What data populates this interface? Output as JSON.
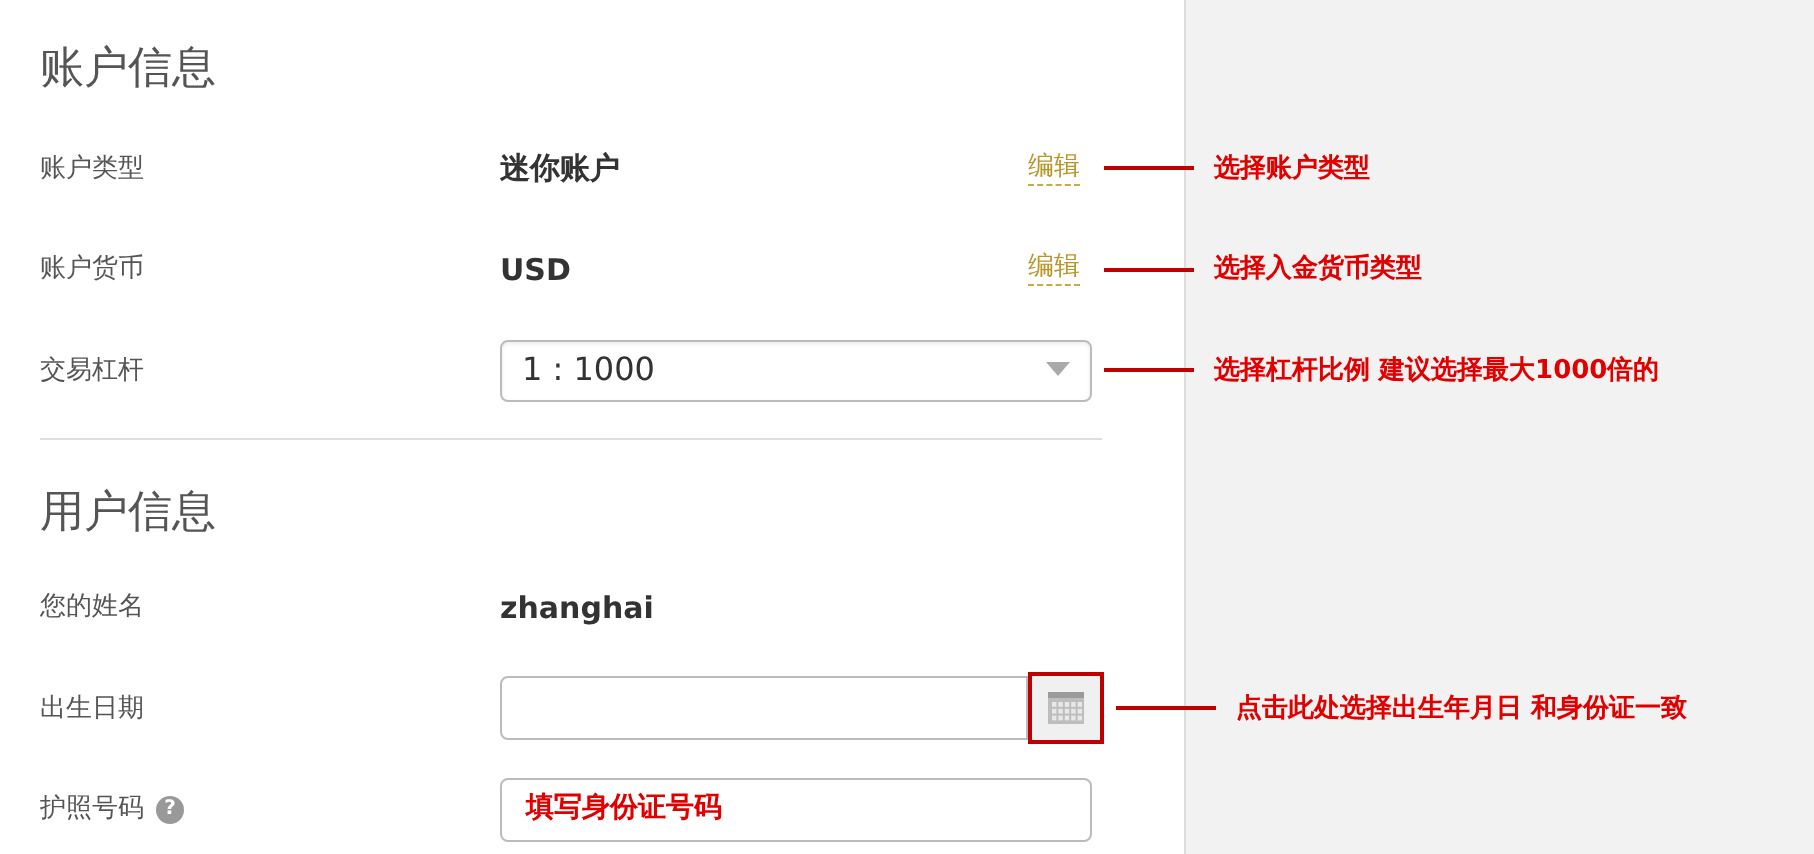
{
  "sections": [
    {
      "title": "账户信息",
      "rows": [
        {
          "kind": "text",
          "label": "账户类型",
          "value": "迷你账户",
          "edit_link": "编辑",
          "annotation": "选择账户类型"
        },
        {
          "kind": "text",
          "label": "账户货币",
          "value": "USD",
          "edit_link": "编辑",
          "annotation": "选择入金货币类型"
        },
        {
          "kind": "select",
          "label": "交易杠杆",
          "value": "1 : 1000",
          "annotation": "选择杠杆比例  建议选择最大1000倍的"
        }
      ]
    },
    {
      "title": "用户信息",
      "rows": [
        {
          "kind": "text",
          "label": "您的姓名",
          "value": "zhanghai"
        },
        {
          "kind": "date",
          "label": "出生日期",
          "highlighted": true,
          "annotation": "点击此处选择出生年月日  和身份证一致"
        },
        {
          "kind": "input",
          "label": "护照号码",
          "help": "?",
          "value": "填写身份证号码"
        }
      ]
    }
  ]
}
